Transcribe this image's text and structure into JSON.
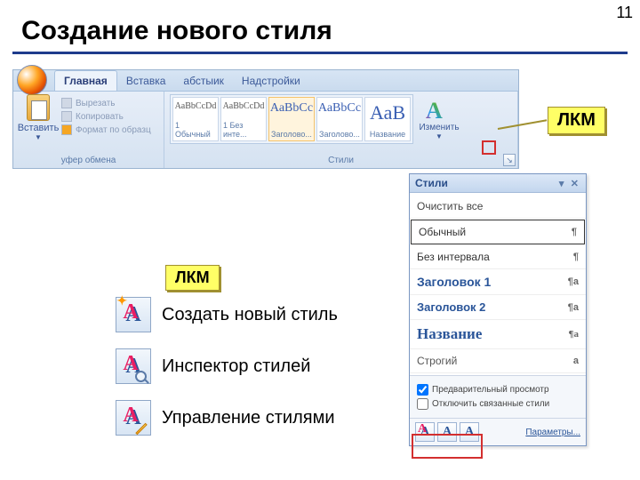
{
  "slide": {
    "number": "11",
    "title": "Создание нового стиля"
  },
  "callouts": {
    "lkm1": "ЛКМ",
    "lkm2": "ЛКМ"
  },
  "ribbon": {
    "tabs": [
      "Главная",
      "Вставка",
      "абстыик",
      "Надстройки"
    ],
    "paste_label": "Вставить",
    "clip_items": [
      "Вырезать",
      "Копировать",
      "Формат по образц"
    ],
    "clip_group_label": "уфер обмена",
    "styles_group_label": "Стили",
    "style_thumbs": [
      {
        "sample": "АаВbСсDd",
        "name": "1 Обычный"
      },
      {
        "sample": "АаВbСсDd",
        "name": "1 Без инте..."
      },
      {
        "sample": "АаВbСс",
        "name": "Заголово..."
      },
      {
        "sample": "АаВbСс",
        "name": "Заголово..."
      },
      {
        "sample": "АаВ",
        "name": "Название"
      }
    ],
    "change_label": "Изменить"
  },
  "pane": {
    "title": "Стили",
    "clear": "Очистить все",
    "items": [
      {
        "label": "Обычный",
        "mark": "¶",
        "cls": "highlighted"
      },
      {
        "label": "Без интервала",
        "mark": "¶",
        "cls": ""
      },
      {
        "label": "Заголовок 1",
        "mark": "¶a",
        "cls": "h1"
      },
      {
        "label": "Заголовок 2",
        "mark": "¶a",
        "cls": "h2"
      },
      {
        "label": "Название",
        "mark": "¶a",
        "cls": "title-s"
      },
      {
        "label": "Строгий",
        "mark": "a",
        "cls": "strict"
      }
    ],
    "preview": "Предварительный просмотр",
    "disable_linked": "Отключить связанные стили",
    "options": "Параметры..."
  },
  "explain": {
    "new_style": "Создать новый стиль",
    "inspector": "Инспектор стилей",
    "manage": "Управление стилями"
  }
}
